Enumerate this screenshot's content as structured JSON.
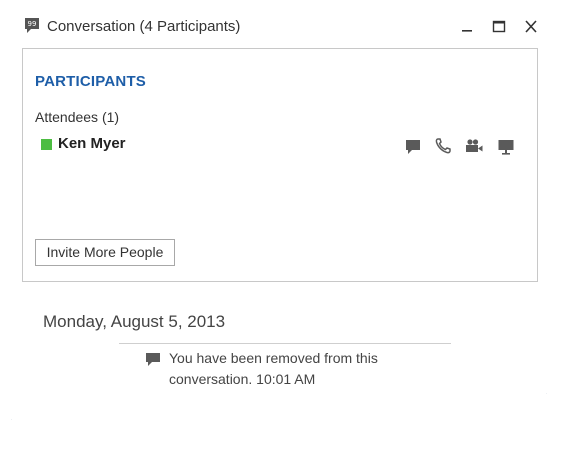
{
  "window": {
    "title": "Conversation (4 Participants)",
    "controls": {
      "minimize": "minimize-icon",
      "maximize": "maximize-icon",
      "close": "close-icon"
    }
  },
  "participants": {
    "header": "PARTICIPANTS",
    "group_label": "Attendees (1)",
    "attendees": [
      {
        "name": "Ken Myer",
        "presence": "available",
        "presence_color": "#4dbd42",
        "actions": [
          "im-icon",
          "phone-icon",
          "video-icon",
          "share-screen-icon"
        ]
      }
    ],
    "invite_button": "Invite More People"
  },
  "conversation": {
    "date": "Monday, August 5, 2013",
    "system_message": "You have been removed from this conversation. 10:01 AM"
  },
  "colors": {
    "accent": "#1e5ea8",
    "border": "#6d8fb0"
  }
}
